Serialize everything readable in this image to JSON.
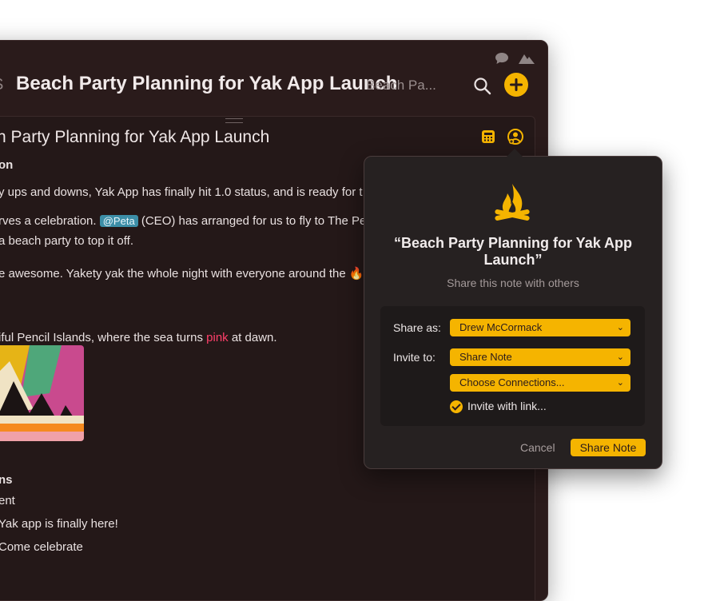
{
  "window": {
    "breadcrumb_partial": "S",
    "title": "Beach Party Planning for Yak App Launch",
    "subtitle": "Beach Pa...",
    "top_icons": [
      "speech-bubble-icon",
      "mountains-icon"
    ],
    "actions": [
      "search-icon",
      "plus-icon"
    ]
  },
  "note": {
    "title": "h Party Planning for Yak App Launch",
    "lines": [
      {
        "text": "on",
        "bold": true
      },
      {
        "text": "y ups and downs, Yak App has finally hit 1.0 status, and is ready for t"
      },
      {
        "pre": "rves a celebration. ",
        "mention": "@Peta",
        "post": " (CEO) has arranged for us to fly to The Pe"
      },
      {
        "text": "a beach party to top it off."
      },
      {
        "pre": "e awesome. Yakety yak the whole night with everyone around the ",
        "emoji": "🔥"
      },
      {
        "pre": "iful Pencil Islands, where the sea turns ",
        "highlight": "pink",
        "post": " at dawn."
      },
      {
        "text": "ns",
        "bold": true
      },
      {
        "text": "ent"
      },
      {
        "text": "Yak app is finally here!"
      },
      {
        "text": "Come celebrate"
      }
    ]
  },
  "share_popover": {
    "title": "“Beach Party Planning for Yak App Launch”",
    "subtitle": "Share this note with others",
    "share_as_label": "Share as:",
    "share_as_value": "Drew McCormack",
    "invite_to_label": "Invite to:",
    "invite_to_value": "Share Note",
    "connections_value": "Choose Connections...",
    "invite_link_label": "Invite with link...",
    "invite_link_checked": true,
    "cancel_label": "Cancel",
    "share_label": "Share Note",
    "icon": "campfire-icon"
  },
  "colors": {
    "accent": "#f5b400",
    "window_bg": "#2a1b1b",
    "popover_bg": "#262121",
    "mention": "#3c8ea7",
    "pink": "#ff3f6a"
  }
}
